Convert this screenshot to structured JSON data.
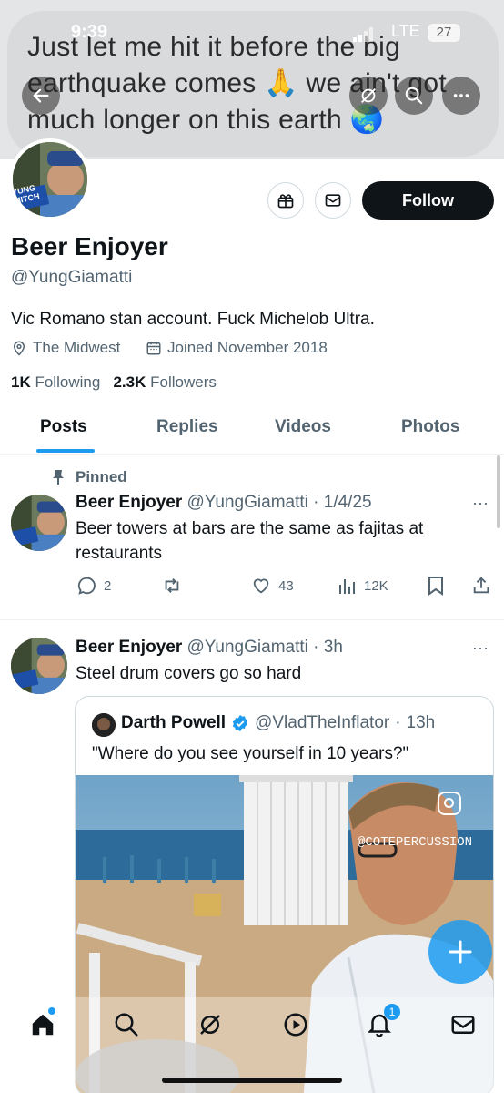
{
  "status_bar": {
    "time": "9:39",
    "network": "LTE",
    "battery": "27"
  },
  "banner_text": "Just let me hit it before the big earthquake comes 🙏 we ain't got much longer on this earth 🌏",
  "profile": {
    "name": "Beer Enjoyer",
    "handle": "@YungGiamatti",
    "bio": "Vic Romano stan account. Fuck Michelob Ultra.",
    "location": "The Midwest",
    "joined": "Joined November 2018",
    "following_count": "1K",
    "following_label": "Following",
    "followers_count": "2.3K",
    "followers_label": "Followers",
    "follow_label": "Follow",
    "avatar_text": "YUNG MITCH"
  },
  "tabs": [
    {
      "label": "Posts",
      "active": true
    },
    {
      "label": "Replies"
    },
    {
      "label": "Videos"
    },
    {
      "label": "Photos"
    }
  ],
  "tweets": [
    {
      "pinned_label": "Pinned",
      "name": "Beer Enjoyer",
      "handle": "@YungGiamatti",
      "time": "1/4/25",
      "text": "Beer towers at bars are the same as fajitas at restaurants",
      "replies": "2",
      "likes": "43",
      "views": "12K",
      "more": "···"
    },
    {
      "name": "Beer Enjoyer",
      "handle": "@YungGiamatti",
      "time": "3h",
      "text": "Steel drum covers go so hard",
      "more": "···",
      "quote": {
        "name": "Darth Powell",
        "handle": "@VladTheInflator",
        "time": "13h",
        "text": "\"Where do you see yourself in 10 years?\"",
        "watermark": "@COTEPERCUSSION"
      }
    }
  ],
  "nav": {
    "notification_count": "1"
  },
  "colors": {
    "accent": "#1d9bf0",
    "text": "#0f1419",
    "muted": "#536471"
  }
}
